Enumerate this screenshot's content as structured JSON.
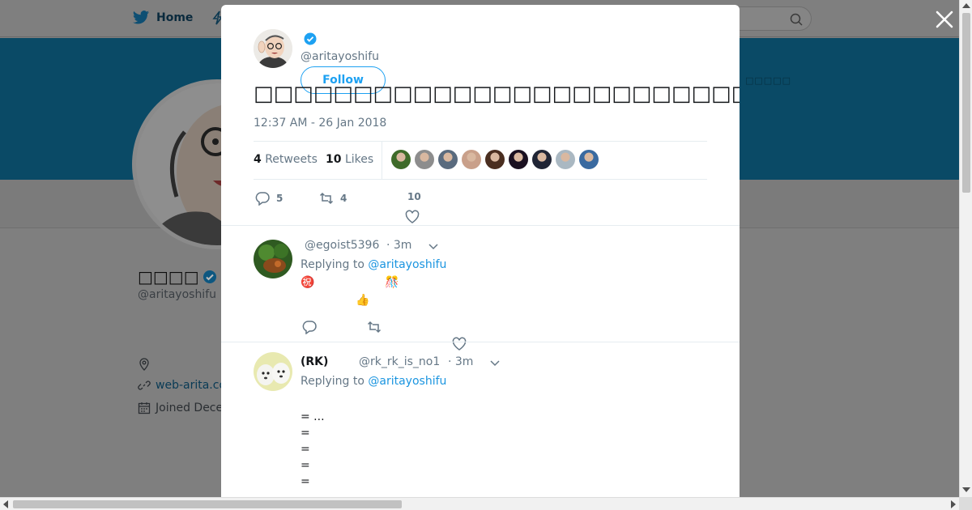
{
  "nav": {
    "home_label": "Home"
  },
  "banner": {
    "text": "□□□□□"
  },
  "profile": {
    "name": "□□□□",
    "handle": "@aritayoshifu",
    "website": "web-arita.co",
    "joined": "Joined Dece"
  },
  "tweet": {
    "handle": "@aritayoshifu",
    "follow_label": "Follow",
    "text": "□□□□□□□□□□□□□□□□□□□□□□□□□□□□□□□□□□□□□□□□□□",
    "time": "12:37 AM - 26 Jan 2018",
    "retweets_count": "4",
    "retweets_label": "Retweets",
    "likes_count": "10",
    "likes_label": "Likes",
    "likers": [
      "#3f6b2a",
      "#8d8d8d",
      "#5a6b7e",
      "#c9a08a",
      "#4a2e20",
      "#1a1020",
      "#202535",
      "#aab8c2",
      "#3a6aa0"
    ],
    "replies": "5",
    "retweets": "4",
    "likes": "10"
  },
  "replies": [
    {
      "name": "",
      "handle": "@egoist5396",
      "age": "· 3m",
      "replying_prefix": "Replying to",
      "replying_to": "@aritayoshifu",
      "emojis": [
        "㊗️",
        "🎊",
        "👍"
      ]
    },
    {
      "name": "(RK)",
      "handle": "@rk_rk_is_no1",
      "age": "· 3m",
      "replying_prefix": "Replying to",
      "replying_to": "@aritayoshifu",
      "lines": [
        "= ...",
        "=",
        "=",
        "=",
        "="
      ]
    }
  ],
  "colors": {
    "accent": "#1da1f2",
    "banner": "#0a4a66",
    "overlay": "#7f7f7f"
  }
}
